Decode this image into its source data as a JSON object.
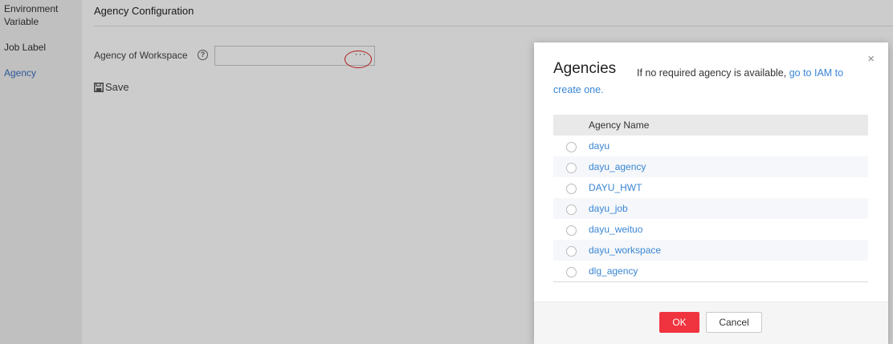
{
  "sidebar": {
    "items": [
      {
        "label": "Environment"
      },
      {
        "label": "Variable"
      },
      {
        "label": "Job Label"
      },
      {
        "label": "Agency"
      }
    ]
  },
  "main": {
    "section_title": "Agency Configuration",
    "field_label": "Agency of Workspace",
    "help_glyph": "?",
    "input_value": "",
    "browse_label": "···",
    "save_label": "Save"
  },
  "dialog": {
    "title": "Agencies",
    "hint_text": "If no required agency is available, ",
    "hint_link": "go to IAM to create one.",
    "close_glyph": "×",
    "column_header": "Agency Name",
    "rows": [
      {
        "name": "dayu"
      },
      {
        "name": "dayu_agency"
      },
      {
        "name": "DAYU_HWT"
      },
      {
        "name": "dayu_job"
      },
      {
        "name": "dayu_weituo"
      },
      {
        "name": "dayu_workspace"
      },
      {
        "name": "dlg_agency"
      }
    ],
    "ok_label": "OK",
    "cancel_label": "Cancel"
  },
  "colors": {
    "link": "#3a86d4",
    "primary_button": "#f0343f",
    "active_nav": "#3a6fc0"
  }
}
